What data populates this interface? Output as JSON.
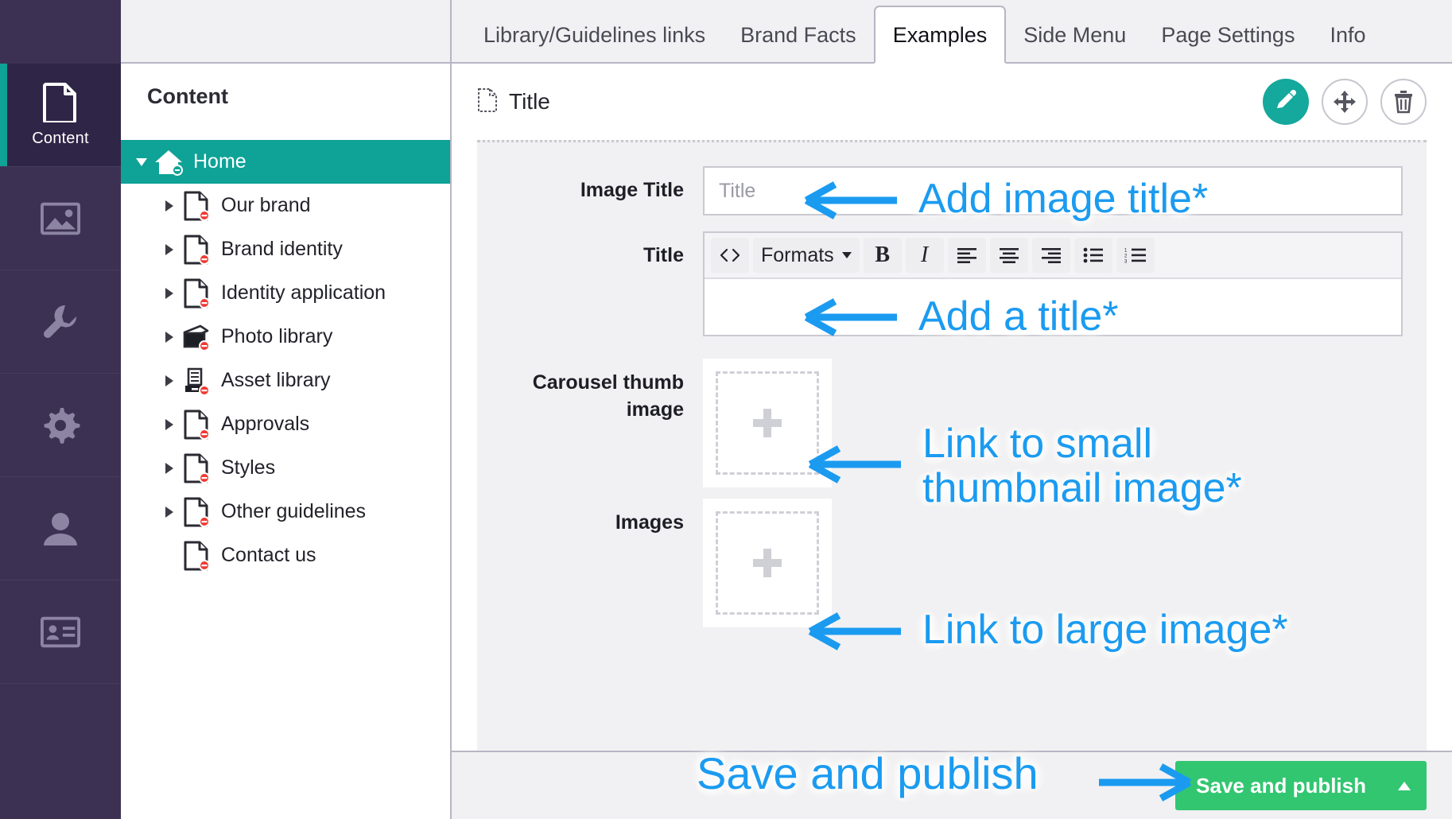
{
  "rail": {
    "items": [
      {
        "label": "Content",
        "icon": "document-icon",
        "active": true
      },
      {
        "label": "",
        "icon": "media-image-icon",
        "active": false
      },
      {
        "label": "",
        "icon": "wrench-icon",
        "active": false
      },
      {
        "label": "",
        "icon": "gear-icon",
        "active": false
      },
      {
        "label": "",
        "icon": "user-icon",
        "active": false
      },
      {
        "label": "",
        "icon": "id-card-icon",
        "active": false
      }
    ]
  },
  "tree": {
    "title": "Content",
    "nodes": [
      {
        "label": "Home",
        "icon": "home-icon",
        "level": 0,
        "expanded": true,
        "hasChildren": true,
        "selected": true
      },
      {
        "label": "Our brand",
        "icon": "document-icon",
        "level": 1,
        "expanded": false,
        "hasChildren": true,
        "selected": false
      },
      {
        "label": "Brand identity",
        "icon": "document-icon",
        "level": 1,
        "expanded": false,
        "hasChildren": true,
        "selected": false
      },
      {
        "label": "Identity application",
        "icon": "document-icon",
        "level": 1,
        "expanded": false,
        "hasChildren": true,
        "selected": false
      },
      {
        "label": "Photo library",
        "icon": "photo-stack-icon",
        "level": 1,
        "expanded": false,
        "hasChildren": true,
        "selected": false
      },
      {
        "label": "Asset library",
        "icon": "file-cabinet-icon",
        "level": 1,
        "expanded": false,
        "hasChildren": true,
        "selected": false
      },
      {
        "label": "Approvals",
        "icon": "document-icon",
        "level": 1,
        "expanded": false,
        "hasChildren": true,
        "selected": false
      },
      {
        "label": "Styles",
        "icon": "document-icon",
        "level": 1,
        "expanded": false,
        "hasChildren": true,
        "selected": false
      },
      {
        "label": "Other guidelines",
        "icon": "document-icon",
        "level": 1,
        "expanded": false,
        "hasChildren": true,
        "selected": false
      },
      {
        "label": "Contact us",
        "icon": "document-icon",
        "level": 1,
        "expanded": false,
        "hasChildren": false,
        "selected": false
      }
    ]
  },
  "tabs": [
    {
      "label": "Library/Guidelines links",
      "active": false
    },
    {
      "label": "Brand Facts",
      "active": false
    },
    {
      "label": "Examples",
      "active": true
    },
    {
      "label": "Side Menu",
      "active": false
    },
    {
      "label": "Page Settings",
      "active": false
    },
    {
      "label": "Info",
      "active": false
    }
  ],
  "doc_header": {
    "title": "Title",
    "icon": "document-outline-icon",
    "actions": [
      {
        "name": "edit-button",
        "icon": "pencil-icon"
      },
      {
        "name": "move-button",
        "icon": "move-arrows-icon"
      },
      {
        "name": "delete-button",
        "icon": "trash-icon"
      }
    ]
  },
  "form": {
    "image_title": {
      "label": "Image Title",
      "value": "",
      "placeholder": "Title"
    },
    "title": {
      "label": "Title",
      "value": "",
      "toolbar": [
        {
          "name": "source-code-button",
          "glyph": "<>",
          "label": ""
        },
        {
          "name": "formats-dropdown",
          "glyph": "",
          "label": "Formats"
        },
        {
          "name": "bold-button",
          "glyph": "B",
          "label": ""
        },
        {
          "name": "italic-button",
          "glyph": "I",
          "label": ""
        },
        {
          "name": "align-left-button",
          "glyph": "",
          "label": ""
        },
        {
          "name": "align-center-button",
          "glyph": "",
          "label": ""
        },
        {
          "name": "align-right-button",
          "glyph": "",
          "label": ""
        },
        {
          "name": "bullet-list-button",
          "glyph": "",
          "label": ""
        },
        {
          "name": "numbered-list-button",
          "glyph": "",
          "label": ""
        }
      ]
    },
    "carousel_thumb": {
      "label": "Carousel thumb image",
      "label_line1": "Carousel thumb",
      "label_line2": "image"
    },
    "images": {
      "label": "Images"
    }
  },
  "footer": {
    "save_label": "Save and publish"
  },
  "annotations": [
    {
      "text": "Add image title*",
      "name": "annotation-add-image-title"
    },
    {
      "text": "Add a title*",
      "name": "annotation-add-a-title"
    },
    {
      "text": "Link to small\nthumbnail image*",
      "name": "annotation-link-small-thumbnail"
    },
    {
      "text": "Link to large image*",
      "name": "annotation-link-large-image"
    },
    {
      "text": "Save and publish",
      "name": "annotation-save-and-publish"
    }
  ],
  "colors": {
    "rail_bg": "#3d3153",
    "rail_active_bg": "#2f2546",
    "accent_teal": "#0fa297",
    "button_teal": "#15a89c",
    "save_green": "#32c671",
    "annotation_blue": "#1b9bf0",
    "panel_grey": "#f1f1f3",
    "border_grey": "#b6b6c4"
  }
}
